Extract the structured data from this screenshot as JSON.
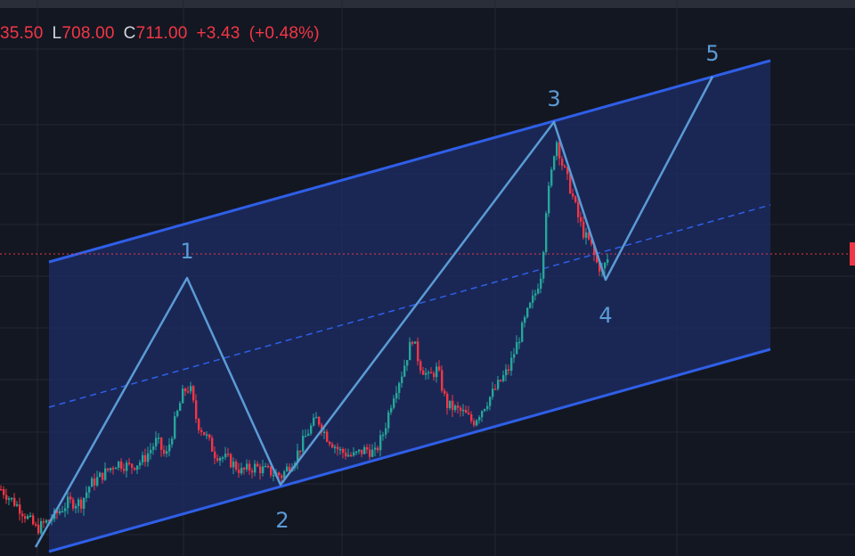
{
  "legend": {
    "open_value": "35.50",
    "low_key": "L",
    "low_value": "708.00",
    "close_key": "C",
    "close_value": "711.00",
    "change": "+3.43",
    "change_pct": "(+0.48%)"
  },
  "colors": {
    "background": "#131722",
    "grid": "#232735",
    "channel_line": "#2f5fe8",
    "channel_fill": "#1c2a5e",
    "wave_line": "#5b9bd5",
    "up_candle": "#26a69a",
    "down_candle": "#f23645",
    "price_line": "#f23645"
  },
  "chart_data": {
    "type": "candlestick",
    "title": "",
    "xlabel": "",
    "ylabel": "",
    "ylim": [
      0,
      624
    ],
    "wave_labels": [
      "1",
      "2",
      "3",
      "4",
      "5"
    ],
    "elliott_wave_points": [
      {
        "label": "",
        "x": 40,
        "y": 10
      },
      {
        "label": "1",
        "x": 210,
        "y": 312
      },
      {
        "label": "2",
        "x": 315,
        "y": 80
      },
      {
        "label": "3",
        "x": 622,
        "y": 487
      },
      {
        "label": "4",
        "x": 680,
        "y": 310
      },
      {
        "label": "5",
        "x": 800,
        "y": 538
      }
    ],
    "channel": {
      "upper": [
        [
          55,
          330
        ],
        [
          865,
          556
        ]
      ],
      "lower": [
        [
          55,
          5
        ],
        [
          865,
          232
        ]
      ],
      "mid": [
        [
          55,
          167
        ],
        [
          865,
          394
        ]
      ]
    },
    "current_price_level": 339,
    "price_path": [
      [
        0,
        75
      ],
      [
        20,
        55
      ],
      [
        40,
        30
      ],
      [
        60,
        45
      ],
      [
        75,
        60
      ],
      [
        90,
        60
      ],
      [
        100,
        80
      ],
      [
        115,
        92
      ],
      [
        130,
        105
      ],
      [
        145,
        100
      ],
      [
        160,
        108
      ],
      [
        175,
        130
      ],
      [
        185,
        110
      ],
      [
        195,
        150
      ],
      [
        205,
        185
      ],
      [
        212,
        190
      ],
      [
        220,
        150
      ],
      [
        230,
        135
      ],
      [
        240,
        115
      ],
      [
        255,
        108
      ],
      [
        270,
        95
      ],
      [
        285,
        100
      ],
      [
        300,
        95
      ],
      [
        315,
        90
      ],
      [
        330,
        110
      ],
      [
        345,
        140
      ],
      [
        355,
        155
      ],
      [
        365,
        135
      ],
      [
        380,
        118
      ],
      [
        395,
        112
      ],
      [
        410,
        120
      ],
      [
        420,
        115
      ],
      [
        430,
        140
      ],
      [
        440,
        180
      ],
      [
        450,
        205
      ],
      [
        462,
        245
      ],
      [
        470,
        215
      ],
      [
        480,
        200
      ],
      [
        490,
        210
      ],
      [
        500,
        170
      ],
      [
        510,
        165
      ],
      [
        520,
        160
      ],
      [
        530,
        150
      ],
      [
        540,
        165
      ],
      [
        550,
        180
      ],
      [
        560,
        195
      ],
      [
        570,
        210
      ],
      [
        580,
        240
      ],
      [
        590,
        270
      ],
      [
        600,
        295
      ],
      [
        607,
        320
      ],
      [
        612,
        390
      ],
      [
        618,
        430
      ],
      [
        623,
        470
      ],
      [
        630,
        440
      ],
      [
        640,
        410
      ],
      [
        648,
        380
      ],
      [
        655,
        360
      ],
      [
        662,
        350
      ],
      [
        668,
        330
      ],
      [
        675,
        320
      ],
      [
        682,
        335
      ]
    ]
  }
}
